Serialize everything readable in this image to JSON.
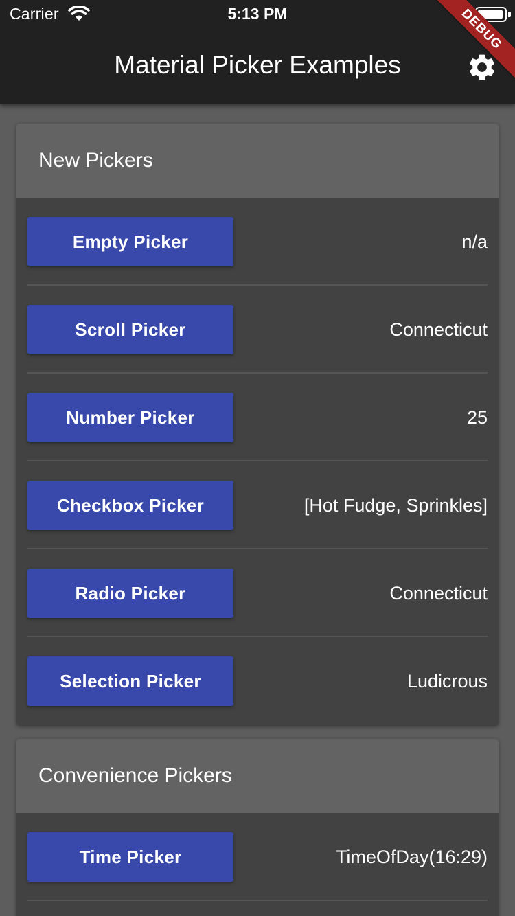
{
  "status_bar": {
    "carrier": "Carrier",
    "time": "5:13 PM",
    "wifi_icon": "wifi-icon",
    "battery_icon": "battery-icon"
  },
  "app_bar": {
    "title": "Material Picker Examples",
    "settings_icon": "gear-icon"
  },
  "debug_banner": "DEBUG",
  "sections": [
    {
      "title": "New Pickers",
      "rows": [
        {
          "button": "Empty Picker",
          "value": "n/a"
        },
        {
          "button": "Scroll Picker",
          "value": "Connecticut"
        },
        {
          "button": "Number Picker",
          "value": "25"
        },
        {
          "button": "Checkbox Picker",
          "value": "[Hot Fudge, Sprinkles]"
        },
        {
          "button": "Radio Picker",
          "value": "Connecticut"
        },
        {
          "button": "Selection Picker",
          "value": "Ludicrous"
        }
      ]
    },
    {
      "title": "Convenience Pickers",
      "rows": [
        {
          "button": "Time Picker",
          "value": "TimeOfDay(16:29)"
        }
      ]
    }
  ],
  "colors": {
    "app_bar": "#212121",
    "background": "#5d5d5d",
    "card": "#424242",
    "card_header": "#636363",
    "button": "#3949ab",
    "debug_ribbon": "#a32222"
  }
}
